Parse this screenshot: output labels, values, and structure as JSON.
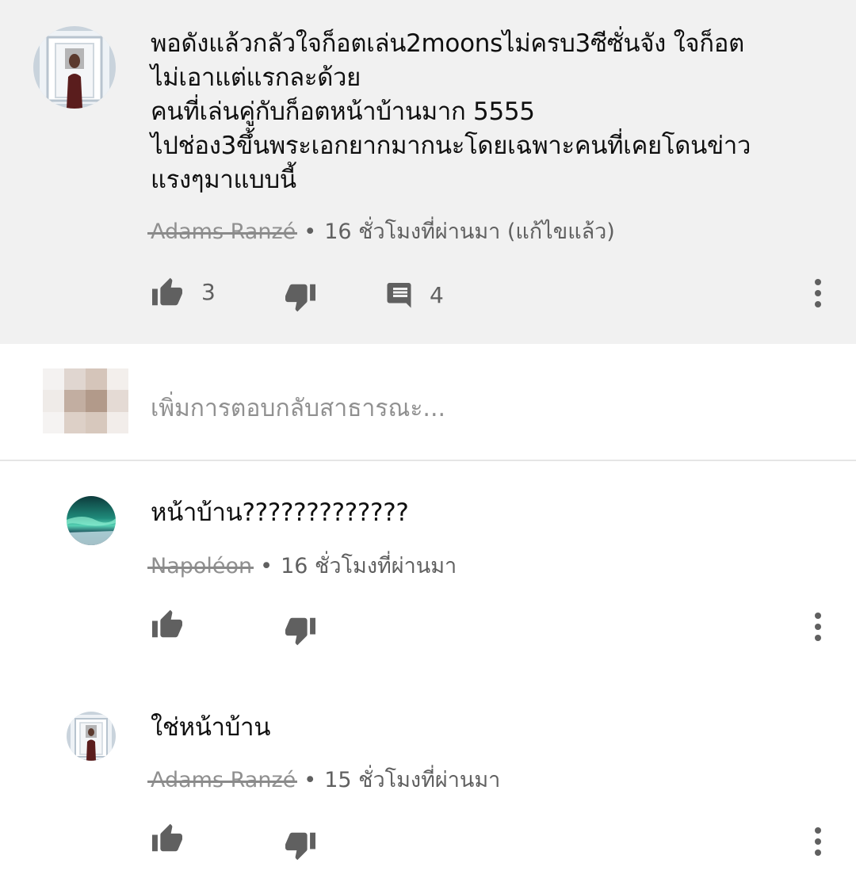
{
  "main_comment": {
    "lines": [
      "พอดังแล้วกลัวใจก็อตเล่น2moonsไม่ครบ3ซีซั่นจัง ใจก็อต",
      "ไม่เอาแต่แรกละด้วย",
      "คนที่เล่นคู่กับก็อตหน้าบ้านมาก 5555",
      "ไปช่อง3ขึ้นพระเอกยากมากนะโดยเฉพาะคนที่เคยโดนข่าว",
      "แรงๆมาแบบนี้"
    ],
    "author": "Adams Ranzé",
    "time": "16 ชั่วโมงที่ผ่านมา (แก้ไขแล้ว)",
    "likes": "3",
    "replies": "4"
  },
  "reply_box": {
    "placeholder": "เพิ่มการตอบกลับสาธารณะ..."
  },
  "replies": [
    {
      "text": "หน้าบ้าน?????????????",
      "author": "Napoléon",
      "time": "16 ชั่วโมงที่ผ่านมา"
    },
    {
      "text": "ใช่หน้าบ้าน",
      "author": "Adams Ranzé",
      "time": "15 ชั่วโมงที่ผ่านมา"
    }
  ],
  "separator": "•",
  "icons": {
    "like": "thumb-up-icon",
    "dislike": "thumb-down-icon",
    "reply": "comment-icon",
    "more": "more-vert-icon"
  },
  "colors": {
    "highlight_bg": "#f1f1f1",
    "icon": "#606060",
    "meta_text": "#606060",
    "placeholder": "#909090"
  }
}
